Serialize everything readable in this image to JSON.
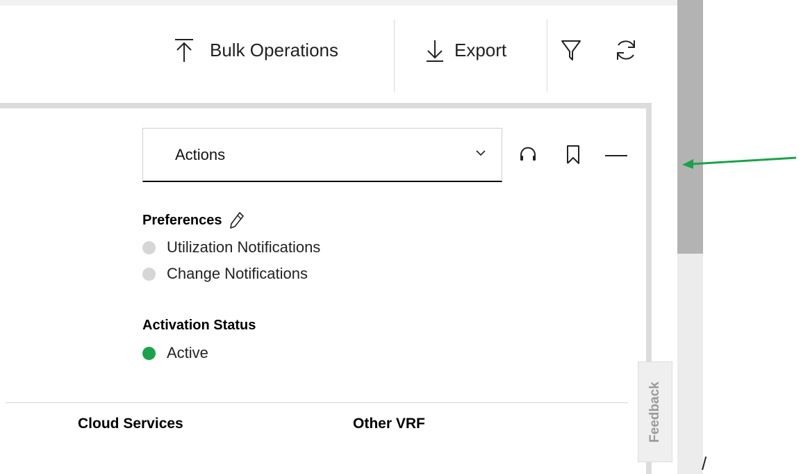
{
  "toolbar": {
    "bulk_operations_label": "Bulk Operations",
    "export_label": "Export",
    "bulk_operations_icon": "upload-arrow-icon",
    "export_icon": "download-arrow-icon",
    "filter_icon": "filter-icon",
    "refresh_icon": "refresh-icon"
  },
  "card": {
    "actions_select": {
      "label": "Actions",
      "icon": "chevron-down-icon"
    },
    "header_icons": [
      "headset-icon",
      "bookmark-icon",
      "minimize-icon"
    ],
    "preferences": {
      "title": "Preferences",
      "edit_icon": "pencil-icon",
      "items": [
        {
          "label": "Utilization Notifications",
          "status_color": "#d6d6d6"
        },
        {
          "label": "Change Notifications",
          "status_color": "#d6d6d6"
        }
      ]
    },
    "activation_status": {
      "title": "Activation Status",
      "value": "Active",
      "status_color": "#1aa34a"
    },
    "columns": [
      "Cloud Services",
      "Other VRF"
    ]
  },
  "feedback": {
    "label": "Feedback"
  },
  "annotation": {
    "arrow_color": "#1aa34a"
  },
  "stray_text": "/"
}
